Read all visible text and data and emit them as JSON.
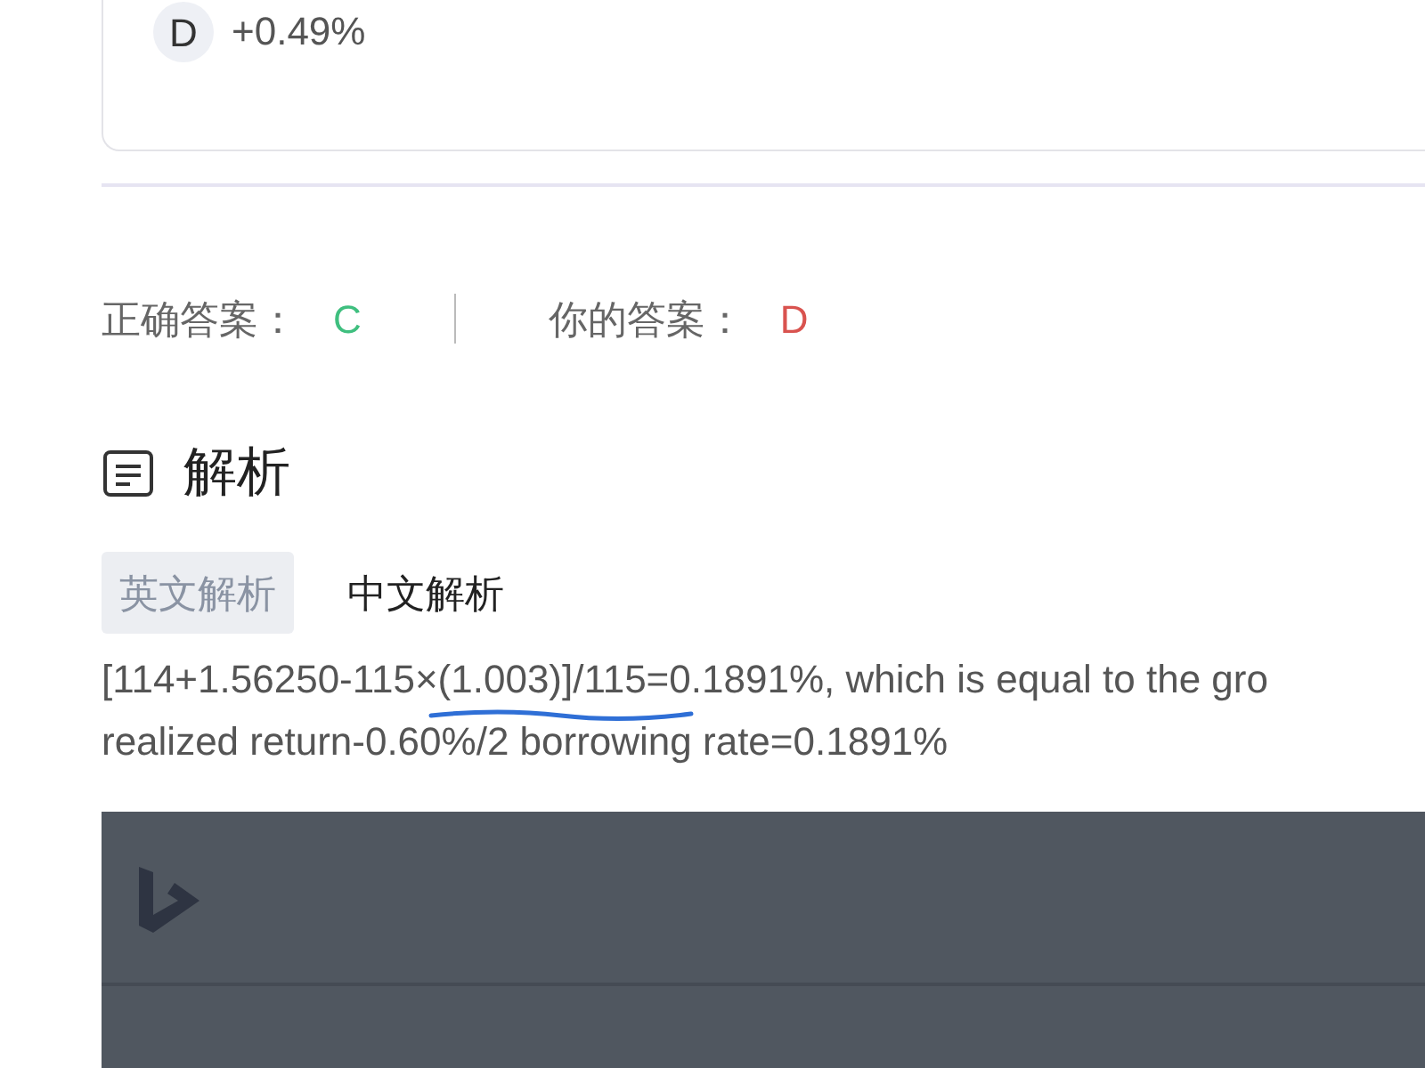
{
  "option": {
    "letter": "D",
    "text": "+0.49%"
  },
  "answers": [
    {
      "label": "正确答案：",
      "value": "C",
      "correct": true
    },
    {
      "label": "你的答案：",
      "value": "D",
      "correct": false
    }
  ],
  "section": {
    "title": "解析"
  },
  "tabs": [
    {
      "label": "英文解析",
      "selected": true
    },
    {
      "label": "中文解析",
      "selected": false
    }
  ],
  "explanation_lines": [
    "[114+1.56250-115×(1.003)]/115=0.1891%, which is equal to the gro",
    "realized return-0.60%/2 borrowing rate=0.1891%"
  ]
}
